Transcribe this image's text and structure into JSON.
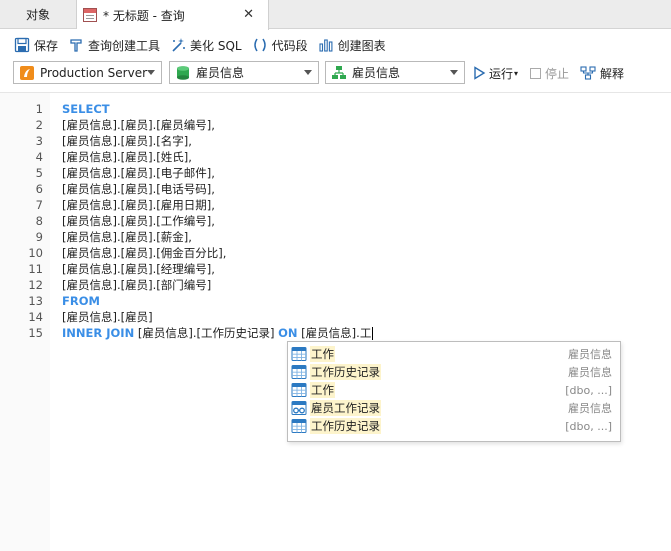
{
  "tabs": {
    "objects_label": "对象",
    "query_label": "* 无标题 - 查询",
    "close_glyph": "✕"
  },
  "toolbar": {
    "save_label": "保存",
    "query_builder_label": "查询创建工具",
    "beautify_label": "美化 SQL",
    "snippet_label": "代码段",
    "chart_label": "创建图表"
  },
  "connection": {
    "server": "Production Server",
    "database": "雇员信息",
    "schema": "雇员信息",
    "run_label": "运行",
    "stop_label": "停止",
    "explain_label": "解释"
  },
  "editor": {
    "lines": [
      {
        "n": "1",
        "text": "SELECT",
        "kw": true
      },
      {
        "n": "2",
        "text": "[雇员信息].[雇员].[雇员编号],",
        "kw": false
      },
      {
        "n": "3",
        "text": "[雇员信息].[雇员].[名字],",
        "kw": false
      },
      {
        "n": "4",
        "text": "[雇员信息].[雇员].[姓氏],",
        "kw": false
      },
      {
        "n": "5",
        "text": "[雇员信息].[雇员].[电子邮件],",
        "kw": false
      },
      {
        "n": "6",
        "text": "[雇员信息].[雇员].[电话号码],",
        "kw": false
      },
      {
        "n": "7",
        "text": "[雇员信息].[雇员].[雇用日期],",
        "kw": false
      },
      {
        "n": "8",
        "text": "[雇员信息].[雇员].[工作编号],",
        "kw": false
      },
      {
        "n": "9",
        "text": "[雇员信息].[雇员].[薪金],",
        "kw": false
      },
      {
        "n": "10",
        "text": "[雇员信息].[雇员].[佣金百分比],",
        "kw": false
      },
      {
        "n": "11",
        "text": "[雇员信息].[雇员].[经理编号],",
        "kw": false
      },
      {
        "n": "12",
        "text": "[雇员信息].[雇员].[部门编号]",
        "kw": false
      },
      {
        "n": "13",
        "text": "FROM",
        "kw": true
      },
      {
        "n": "14",
        "text": "[雇员信息].[雇员]",
        "kw": false
      }
    ],
    "last_line": {
      "n": "15",
      "kw1": "INNER JOIN",
      "table": " [雇员信息].[工作历史记录] ",
      "kw2": "ON",
      "rest": " [雇员信息].工"
    }
  },
  "autocomplete": [
    {
      "name": "工作",
      "source": "雇员信息",
      "icon": "table-icon"
    },
    {
      "name": "工作历史记录",
      "source": "雇员信息",
      "icon": "table-icon"
    },
    {
      "name": "工作",
      "source": "[dbo, ...]",
      "icon": "table-icon"
    },
    {
      "name": "雇员工作记录",
      "source": "雇员信息",
      "icon": "view-icon"
    },
    {
      "name": "工作历史记录",
      "source": "[dbo, ...]",
      "icon": "table-icon"
    }
  ],
  "colors": {
    "keyword": "#3a8ee6",
    "match_highlight": "#fdf4cc",
    "db_icon": "#2fa84f",
    "accent": "#2b6cb0"
  }
}
